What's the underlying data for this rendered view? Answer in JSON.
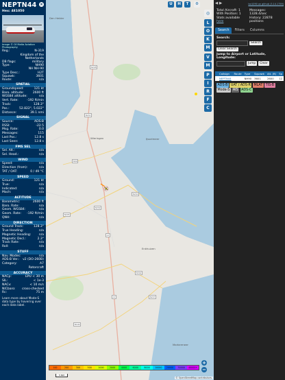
{
  "aircraft": {
    "callsign": "NEPTN44",
    "hex": "Hex: 481050",
    "photo_credit": "Image © Of Malta Aviation Photography",
    "details": [
      {
        "k": "Reg.:",
        "v": "N-319"
      },
      {
        "k": "",
        "v": "Kingdom of the\nNetherlands"
      },
      {
        "k": "DB flags:",
        "v": "military"
      },
      {
        "k": "Type:",
        "v": "NH90"
      },
      {
        "k": "",
        "v": "NH NH-90"
      },
      {
        "k": "Type Desc.:",
        "v": "H2T"
      },
      {
        "k": "Squawk:",
        "v": "3601"
      },
      {
        "k": "Route:",
        "v": "n/a"
      }
    ],
    "sections": [
      {
        "title": "SPATIAL",
        "rows": [
          {
            "k": "Groundspeed:",
            "v": "121 kt"
          },
          {
            "k": "Baro. altitude:",
            "v": "2600 ft"
          },
          {
            "k": "WGS84 altitude:",
            "v": "n/a"
          },
          {
            "k": "Vert. Rate:",
            "v": "-192 ft/min"
          },
          {
            "k": "Track:",
            "v": "128.3°"
          },
          {
            "k": "Pos.:",
            "v": "52.822°, 5.022°"
          },
          {
            "k": "Distance:",
            "v": "39.1 nmi"
          }
        ]
      },
      {
        "title": "SIGNAL",
        "rows": [
          {
            "k": "Source:",
            "v": "ADS-B"
          },
          {
            "k": "RSSI:",
            "v": "-22.5"
          },
          {
            "k": "Msg. Rate:",
            "v": "0.0"
          },
          {
            "k": "Messages:",
            "v": "115"
          },
          {
            "k": "Last Pos.:",
            "v": "12.8 s"
          },
          {
            "k": "Last Seen:",
            "v": "12.8 s"
          }
        ]
      },
      {
        "title": "FMS SEL",
        "rows": [
          {
            "k": "Sel. Alt.:",
            "v": "n/a"
          },
          {
            "k": "Sel. Head.:",
            "v": "n/a"
          }
        ]
      },
      {
        "title": "WIND",
        "rows": [
          {
            "k": "Speed:",
            "v": "n/a"
          },
          {
            "k": "Direction (from):",
            "v": "n/a"
          },
          {
            "k": "TAT / OAT:",
            "v": "0 / 49 °C"
          }
        ]
      },
      {
        "title": "SPEED",
        "rows": [
          {
            "k": "Ground:",
            "v": "121 kt"
          },
          {
            "k": "True:",
            "v": "n/a"
          },
          {
            "k": "Indicated:",
            "v": "n/a"
          },
          {
            "k": "Mach:",
            "v": "n/a"
          }
        ]
      },
      {
        "title": "ALTITUDE",
        "rows": [
          {
            "k": "Barometric:",
            "v": "2600 ft"
          },
          {
            "k": "Baro. Rate:",
            "v": "n/a"
          },
          {
            "k": "Geom. WGS84:",
            "v": "n/a"
          },
          {
            "k": "Geom. Rate:",
            "v": "-192 ft/min"
          },
          {
            "k": "QNH:",
            "v": "n/a"
          }
        ]
      },
      {
        "title": "DIRECTION",
        "rows": [
          {
            "k": "Ground Track:",
            "v": "128.3°"
          },
          {
            "k": "True Heading:",
            "v": "n/a"
          },
          {
            "k": "Magnetic Heading:",
            "v": "n/a"
          },
          {
            "k": "Magnetic Decl.:",
            "v": "2.3°"
          },
          {
            "k": "Track Rate:",
            "v": "n/a"
          },
          {
            "k": "Roll:",
            "v": "n/a"
          }
        ]
      },
      {
        "title": "STUFF",
        "rows": [
          {
            "k": "Nav. Modes:",
            "v": "n/a"
          },
          {
            "k": "ADS-B Ver.:",
            "v": "v2 (DO-260B)"
          },
          {
            "k": "Category:",
            "v": "A7"
          },
          {
            "k": "",
            "v": "Rotorcraft"
          }
        ]
      },
      {
        "title": "ACCURACY",
        "rows": [
          {
            "k": "NACp:",
            "v": "EPU < 30 m"
          },
          {
            "k": "SIL:",
            "v": "< 1e-3"
          },
          {
            "k": "NACv:",
            "v": "< 10 m/s"
          },
          {
            "k": "NICbaro:",
            "v": "cross-checked"
          },
          {
            "k": "Rc:",
            "v": "75 m"
          }
        ]
      }
    ],
    "footer_note": "Learn more about Mode-S data type by hovering over each data label."
  },
  "map": {
    "top_buttons": [
      "U",
      "H",
      "T"
    ],
    "side_buttons": [
      "L",
      "O",
      "K",
      "M",
      "P",
      "I",
      "R",
      "F",
      "C"
    ],
    "toggle_buttons": [
      "V",
      "M"
    ],
    "places": [
      "Wieringen",
      "Den Helder",
      "Enkhuizen",
      "Markermeer",
      "IJsselmeer"
    ],
    "road_tags": [
      "N99",
      "N248",
      "N241",
      "N242",
      "A7",
      "N240",
      "N245",
      "A7",
      "N302",
      "N194",
      "N247"
    ],
    "legend": [
      "100",
      "200",
      "300",
      "500",
      "1000",
      "2000",
      "4000",
      "6000",
      "8000",
      "10000",
      "20000",
      "30000",
      "40000+"
    ],
    "legend_colors": [
      "#ff6a00",
      "#ff9500",
      "#ffc300",
      "#ffe100",
      "#d9ff00",
      "#8cff00",
      "#00ff4a",
      "#00ff9d",
      "#00ffe9",
      "#00c3ff",
      "#0062ff",
      "#7a3dff",
      "#d500ff"
    ],
    "scale_label": "5 NM",
    "attribution": "© OpenStreetMap contributors.",
    "zoom_in": "+",
    "zoom_out": "−"
  },
  "sidebar": {
    "version_link": "tar1090 on github (3.14.1759)",
    "total_aircraft": "Total Aircraft: 1",
    "with_position": "With Position: 1",
    "stats_label": "Stats available",
    "stats_link": "here",
    "messages": "Messages: 1328.4/sec",
    "history": "History: 22878 positions",
    "tabs": [
      "Search",
      "Filters",
      "Columns"
    ],
    "search_label": "Search:",
    "search_button": "Search",
    "clear_search": "Clear Search",
    "jump_label": "Jump to Airport or Latitude, Longitude:",
    "jump_button": "Jump",
    "clear_button": "Clear",
    "table_headers": [
      "",
      "Callsign",
      "Route",
      "Type",
      "Squawk",
      "Alt. (ft)",
      "Sp"
    ],
    "table_rows": [
      [
        "",
        "NEPTN44",
        "",
        "NH90",
        "3601",
        "2600",
        "12"
      ]
    ],
    "badges": [
      {
        "label": "ADS-B",
        "color": "#6ab0e0"
      },
      {
        "label": "UAT / ADS-R",
        "color": "#e0d26a"
      },
      {
        "label": "MLAT",
        "color": "#e07f6a"
      },
      {
        "label": "TIS-B",
        "color": "#e07fa0"
      },
      {
        "label": "Mode-S",
        "color": "#cccccc"
      },
      {
        "label": "AIS",
        "color": "#666666"
      },
      {
        "label": "ADS-C",
        "color": "#8fd38f"
      }
    ]
  }
}
